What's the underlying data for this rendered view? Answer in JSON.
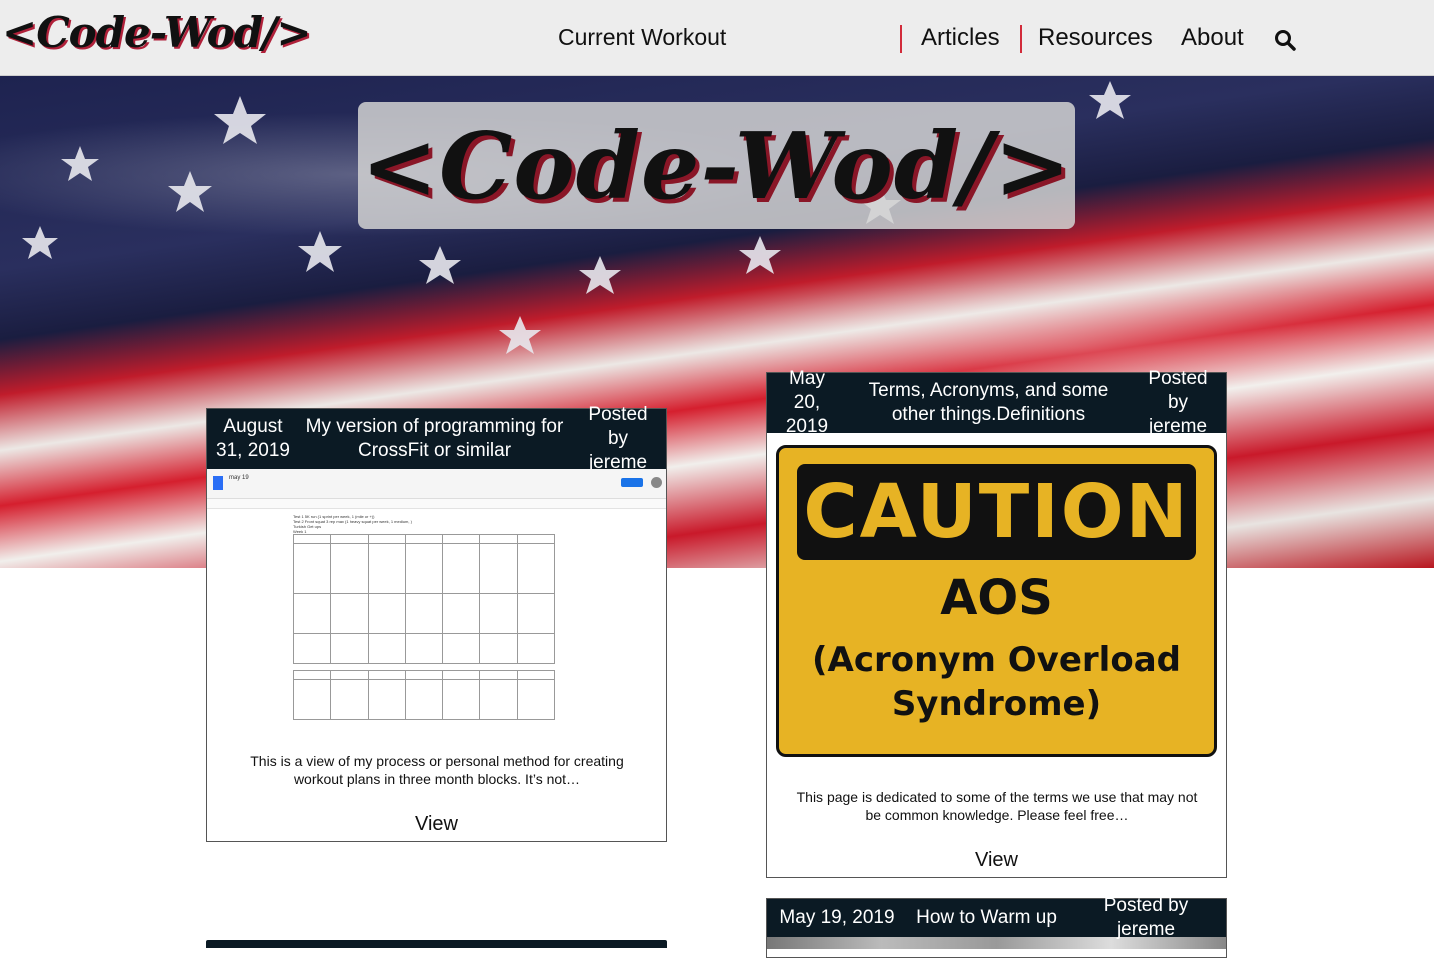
{
  "nav": {
    "logo": "<Code-Wod/>",
    "current_workout": "Current Workout",
    "articles": "Articles",
    "resources": "Resources",
    "about": "About",
    "search_icon": "search-icon"
  },
  "hero": {
    "logo": "<Code-Wod/>"
  },
  "posts": [
    {
      "date": "August 31, 2019",
      "title": "My version of programming for CrossFit or similar",
      "author": "Posted by jereme",
      "excerpt": "This is a view of my process or personal method for creating workout plans in three month blocks.  It’s not…",
      "view": "View",
      "doc_title": "may 19",
      "doc_lines": [
        "Test 1 5K run (1 sprint per week, 1 (mile or +))",
        "Test 2 Front squat 3 rep max (1 heavy squat per week, 1 medium, )",
        "Turkish Get ups",
        "Week 1"
      ]
    },
    {
      "date": "May 20, 2019",
      "title": "Terms, Acronyms, and some other things.Definitions",
      "author": "Posted by jereme",
      "excerpt": "This page is dedicated to some of the terms we use that may not be common knowledge.  Please feel free…",
      "view": "View",
      "sign": {
        "heading": "CAUTION",
        "main": "AOS",
        "sub_line1": "(Acronym Overload",
        "sub_line2": "Syndrome)"
      }
    },
    {
      "date": "May 19, 2019",
      "title": "How to Warm up",
      "author": "Posted by jereme"
    }
  ],
  "colors": {
    "accent_red": "#d22b3a",
    "card_header": "#0b1a24",
    "sign_yellow": "#e7b324"
  }
}
